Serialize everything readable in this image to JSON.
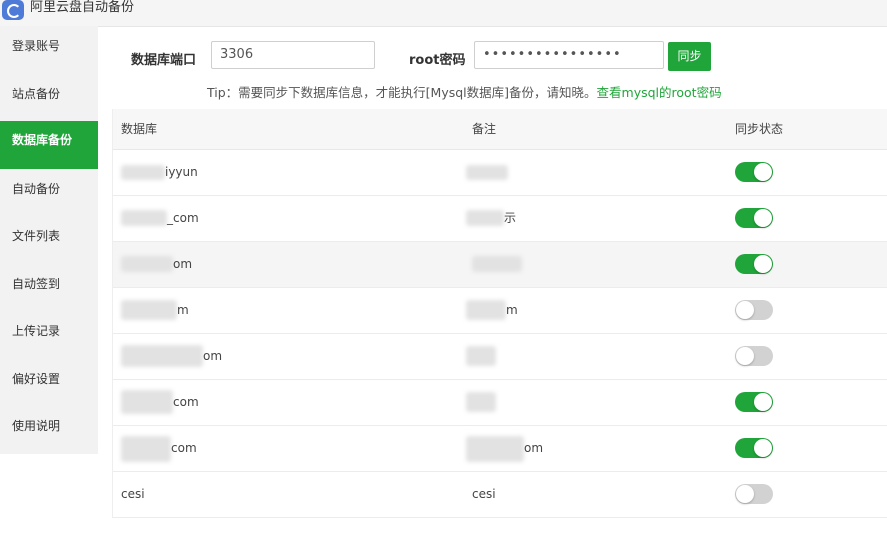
{
  "app": {
    "title": "阿里云盘自动备份",
    "icon": "cloud-drive-logo-icon"
  },
  "sidebar": {
    "items": [
      {
        "label": "登录账号",
        "active": false
      },
      {
        "label": "站点备份",
        "active": false
      },
      {
        "label": "数据库备份",
        "active": true
      },
      {
        "label": "自动备份",
        "active": false
      },
      {
        "label": "文件列表",
        "active": false
      },
      {
        "label": "自动签到",
        "active": false
      },
      {
        "label": "上传记录",
        "active": false
      },
      {
        "label": "偏好设置",
        "active": false
      },
      {
        "label": "使用说明",
        "active": false
      }
    ]
  },
  "form": {
    "port_label": "数据库端口",
    "port_value": "3306",
    "password_label": "root密码",
    "password_value": "••••••••••••••••",
    "sync_button": "同步"
  },
  "tip": {
    "text": "Tip：需要同步下数据库信息，才能执行[Mysql数据库]备份，请知晓。",
    "link": "查看mysql的root密码"
  },
  "table": {
    "headers": [
      "数据库",
      "备注",
      "同步状态"
    ],
    "rows": [
      {
        "database": "iyyun",
        "remark": "",
        "synced": true
      },
      {
        "database": "_com",
        "remark": "示",
        "synced": true
      },
      {
        "database": "om",
        "remark": "",
        "synced": true
      },
      {
        "database": "m",
        "remark": "m",
        "synced": false
      },
      {
        "database": "om",
        "remark": "",
        "synced": false
      },
      {
        "database": "com",
        "remark": "",
        "synced": true
      },
      {
        "database": "com",
        "remark": "om",
        "synced": true
      },
      {
        "database": "cesi",
        "remark": "cesi",
        "synced": false
      }
    ]
  },
  "colors": {
    "accent": "#20a53a",
    "toggle_off": "#d2d2d2",
    "sidebar_bg": "#f2f2f2"
  }
}
